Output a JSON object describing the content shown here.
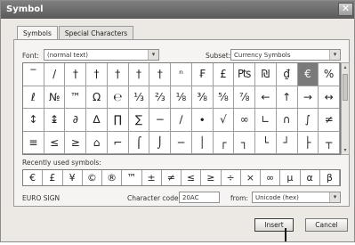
{
  "window": {
    "title": "Symbol",
    "close_glyph": "✕"
  },
  "tabs": [
    {
      "label": "Symbols",
      "active": true
    },
    {
      "label": "Special Characters",
      "active": false
    }
  ],
  "font": {
    "label": "Font:",
    "value": "(normal text)"
  },
  "subset": {
    "label": "Subset:",
    "value": "Currency Symbols"
  },
  "symbols": [
    "‾",
    "/",
    "†",
    "†",
    "†",
    "†",
    "†",
    "ⁿ",
    "₣",
    "£",
    "₧",
    "₪",
    "₫",
    "€",
    "%",
    "ℓ",
    "№",
    "™",
    "Ω",
    "℮",
    "⅓",
    "⅔",
    "⅛",
    "⅜",
    "⅝",
    "⅞",
    "←",
    "↑",
    "→",
    "↓",
    "↔",
    "↕",
    "↨",
    "∂",
    "∆",
    "∏",
    "∑",
    "−",
    "∕",
    "∙",
    "√",
    "∞",
    "∟",
    "∩",
    "∫",
    "≈",
    "≠",
    "≡",
    "≤",
    "≥",
    "⌂",
    "⌐",
    "⌠",
    "⌡",
    "─",
    "│",
    "┌",
    "┐",
    "└",
    "┘",
    "├",
    "┤",
    "┬"
  ],
  "grid_rows": [
    [
      "‾",
      "/",
      "†",
      "†",
      "†",
      "†",
      "†",
      "ⁿ",
      "₣",
      "£",
      "₧",
      "₪",
      "₫",
      "€"
    ],
    [
      "ℓ",
      "№",
      "™",
      "Ω",
      "℮",
      "⅓",
      "⅔",
      "⅛",
      "⅜",
      "⅝",
      "⅞",
      "←",
      "↑",
      "→"
    ],
    [
      "↕",
      "↨",
      "∂",
      "∆",
      "∏",
      "∑",
      "−",
      "∕",
      "∙",
      "√",
      "∞",
      "∟",
      "∩",
      "∫"
    ],
    [
      "≡",
      "≤",
      "≥",
      "⌂",
      "⌐",
      "⌠",
      "⌡",
      "─",
      "│",
      "┌",
      "┐",
      "└",
      "┘",
      "├"
    ]
  ],
  "grid_extra_col": [
    "%",
    "↔",
    "≠",
    "┬"
  ],
  "selected_symbol": "€",
  "recent": {
    "label": "Recently used symbols:",
    "items": [
      "€",
      "£",
      "¥",
      "©",
      "®",
      "™",
      "±",
      "≠",
      "≤",
      "≥",
      "÷",
      "×",
      "∞",
      "µ",
      "α",
      "β"
    ]
  },
  "char_name": "EURO SIGN",
  "char_code": {
    "label": "Character code:",
    "value": "20AC"
  },
  "from": {
    "label": "from:",
    "value": "Unicode (hex)"
  },
  "buttons": {
    "insert": "Insert",
    "cancel": "Cancel"
  },
  "icons": {
    "dropdown_arrow": "▾",
    "scroll_up": "▴",
    "scroll_down": "▾"
  },
  "colors": {
    "selected_cell": "#7a7a7a",
    "titlebar": "#6a6a6a"
  }
}
